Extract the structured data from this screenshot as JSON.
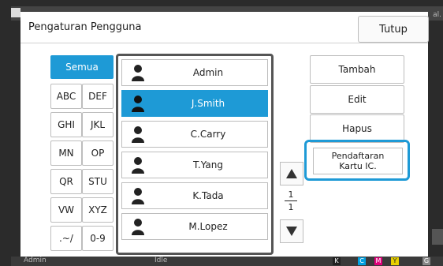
{
  "background": {
    "corner_text": "al.",
    "status_user": "Admin",
    "status_state": "Idle",
    "ink": [
      "K",
      "C",
      "M",
      "Y",
      "G"
    ]
  },
  "dialog": {
    "title": "Pengaturan Pengguna",
    "close_label": "Tutup"
  },
  "filters": {
    "all": "Semua",
    "keys": [
      "ABC",
      "DEF",
      "GHI",
      "JKL",
      "MN",
      "OP",
      "QR",
      "STU",
      "VW",
      "XYZ",
      ".~/",
      "0-9"
    ]
  },
  "users": [
    {
      "name": "Admin",
      "selected": false
    },
    {
      "name": "J.Smith",
      "selected": true
    },
    {
      "name": "C.Carry",
      "selected": false
    },
    {
      "name": "T.Yang",
      "selected": false
    },
    {
      "name": "K.Tada",
      "selected": false
    },
    {
      "name": "M.Lopez",
      "selected": false
    }
  ],
  "pager": {
    "current": "1",
    "total": "1"
  },
  "actions": {
    "add": "Tambah",
    "edit": "Edit",
    "delete": "Hapus",
    "ic_card_line1": "Pendaftaran",
    "ic_card_line2": "Kartu IC."
  },
  "colors": {
    "accent": "#1e9ad6",
    "frame": "#555555"
  }
}
